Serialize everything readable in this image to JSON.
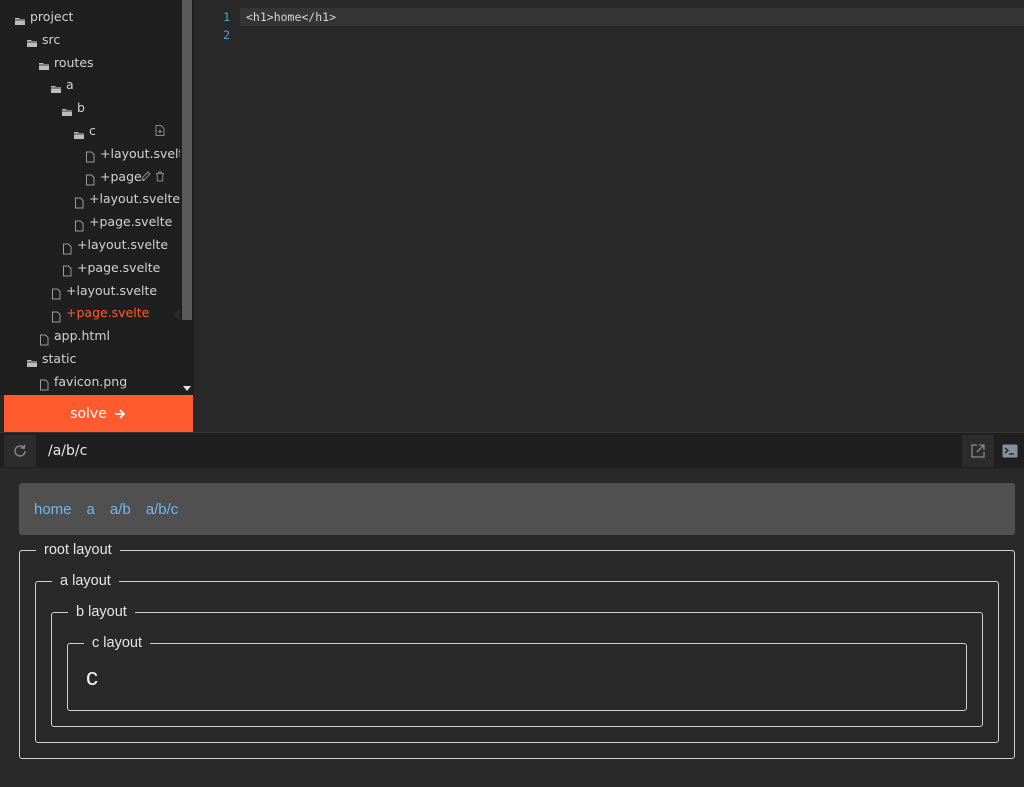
{
  "tree": {
    "items": [
      {
        "label": "project",
        "kind": "folder"
      },
      {
        "label": "src",
        "kind": "folder"
      },
      {
        "label": "routes",
        "kind": "folder"
      },
      {
        "label": "a",
        "kind": "folder"
      },
      {
        "label": "b",
        "kind": "folder"
      },
      {
        "label": "c",
        "kind": "folder"
      },
      {
        "label": "+layout.svelte",
        "kind": "file"
      },
      {
        "label": "+page.",
        "kind": "file"
      },
      {
        "label": "+layout.svelte",
        "kind": "file"
      },
      {
        "label": "+page.svelte",
        "kind": "file"
      },
      {
        "label": "+layout.svelte",
        "kind": "file"
      },
      {
        "label": "+page.svelte",
        "kind": "file"
      },
      {
        "label": "+layout.svelte",
        "kind": "file"
      },
      {
        "label": "+page.svelte",
        "kind": "file",
        "active": true
      },
      {
        "label": "app.html",
        "kind": "file"
      },
      {
        "label": "static",
        "kind": "folder"
      },
      {
        "label": "favicon.png",
        "kind": "file"
      }
    ],
    "folder_actions": [
      "new-file-icon"
    ],
    "file_actions": [
      "pencil-icon",
      "trash-icon"
    ]
  },
  "solve": {
    "label": "solve",
    "icon": "arrow-right-icon"
  },
  "editor": {
    "line_numbers": [
      "1",
      "2"
    ],
    "lines": [
      "<h1>home</h1>",
      ""
    ]
  },
  "toolbar": {
    "url": "/a/b/c",
    "icons": [
      "reload-icon",
      "open-external-icon",
      "terminal-icon"
    ]
  },
  "preview": {
    "nav_links": [
      "home",
      "a",
      "a/b",
      "a/b/c"
    ],
    "layouts": [
      "root layout",
      "a layout",
      "b layout",
      "c layout"
    ],
    "content": "c"
  },
  "colors": {
    "accent": "#ff5b2e",
    "link": "#6db8f0",
    "sidebar_bg": "#1f1f1f",
    "editor_bg": "#282828"
  }
}
